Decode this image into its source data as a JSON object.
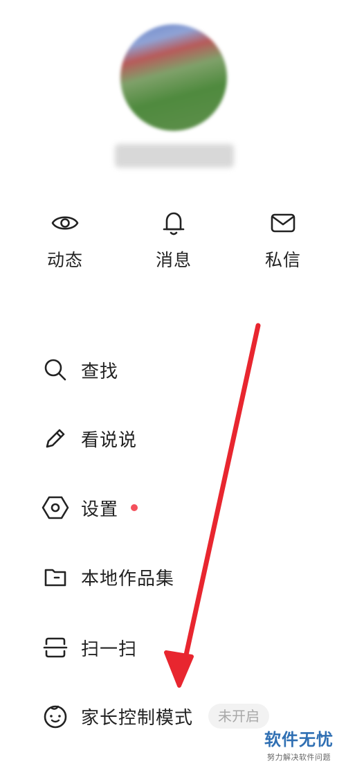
{
  "profile": {
    "avatar_icon": "user-avatar-blurred",
    "username": ""
  },
  "quick_actions": [
    {
      "label": "动态",
      "icon": "eye-icon"
    },
    {
      "label": "消息",
      "icon": "bell-icon"
    },
    {
      "label": "私信",
      "icon": "mail-icon"
    }
  ],
  "menu": {
    "items": [
      {
        "label": "查找",
        "icon": "search-icon"
      },
      {
        "label": "看说说",
        "icon": "pencil-icon"
      },
      {
        "label": "设置",
        "icon": "settings-hexagon-icon",
        "has_red_dot": true
      },
      {
        "label": "本地作品集",
        "icon": "folder-icon"
      },
      {
        "label": "扫一扫",
        "icon": "scan-icon"
      },
      {
        "label": "家长控制模式",
        "icon": "child-face-icon",
        "status": "未开启"
      }
    ]
  },
  "annotation": {
    "color": "#e8262f",
    "icon": "red-arrow-pointing-down"
  },
  "watermark": {
    "title": "软件无忧",
    "subtitle": "努力解决软件问题"
  }
}
